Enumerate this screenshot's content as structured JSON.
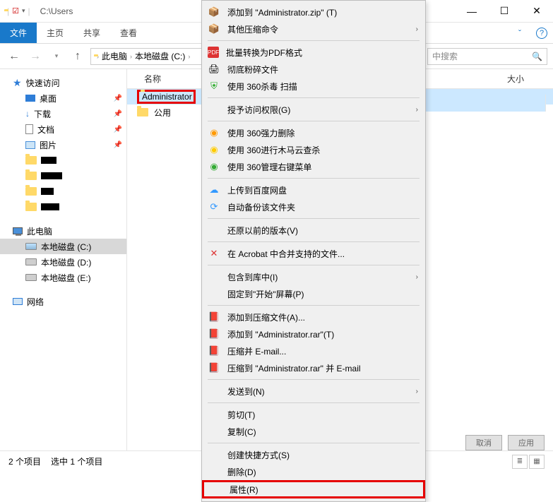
{
  "titlebar": {
    "path": "C:\\Users"
  },
  "winctl": {
    "min": "—",
    "max": "☐",
    "close": "✕"
  },
  "ribbon": {
    "file": "文件",
    "home": "主页",
    "share": "共享",
    "view": "查看"
  },
  "nav": {
    "back": "←",
    "fwd": "→",
    "up": "↑"
  },
  "breadcrumb": {
    "thispc": "此电脑",
    "drive": "本地磁盘 (C:)"
  },
  "search": {
    "placeholder": "中搜索"
  },
  "sidebar": {
    "quick": "快速访问",
    "desktop": "桌面",
    "downloads": "下载",
    "documents": "文档",
    "pictures": "图片",
    "thispc": "此电脑",
    "drivec": "本地磁盘 (C:)",
    "drived": "本地磁盘 (D:)",
    "drivee": "本地磁盘 (E:)",
    "network": "网络"
  },
  "listhdr": {
    "name": "名称",
    "size": "大小"
  },
  "rows": {
    "admin": "Administrator",
    "public": "公用"
  },
  "status": {
    "count": "2 个项目",
    "sel": "选中 1 个项目"
  },
  "ctx": {
    "addzip": "添加到 \"Administrator.zip\" (T)",
    "othercomp": "其他压缩命令",
    "pdfbatch": "批量转换为PDF格式",
    "shred": "彻底粉碎文件",
    "scan360": "使用 360杀毒 扫描",
    "grant": "授予访问权限(G)",
    "forcedel": "使用 360强力删除",
    "trojan": "使用 360进行木马云查杀",
    "ctxmgr": "使用 360管理右键菜单",
    "baidu": "上传到百度网盘",
    "autobk": "自动备份该文件夹",
    "restore": "还原以前的版本(V)",
    "acrobat": "在 Acrobat 中合并支持的文件...",
    "library": "包含到库中(I)",
    "pinstart": "固定到\"开始\"屏幕(P)",
    "addarch": "添加到压缩文件(A)...",
    "addrar": "添加到 \"Administrator.rar\"(T)",
    "emailcomp": "压缩并 E-mail...",
    "emailrar": "压缩到 \"Administrator.rar\" 并 E-mail",
    "sendto": "发送到(N)",
    "cut": "剪切(T)",
    "copy": "复制(C)",
    "shortcut": "创建快捷方式(S)",
    "delete": "删除(D)",
    "props": "属性(R)"
  },
  "btns": {
    "a": "取消",
    "b": "应用"
  }
}
